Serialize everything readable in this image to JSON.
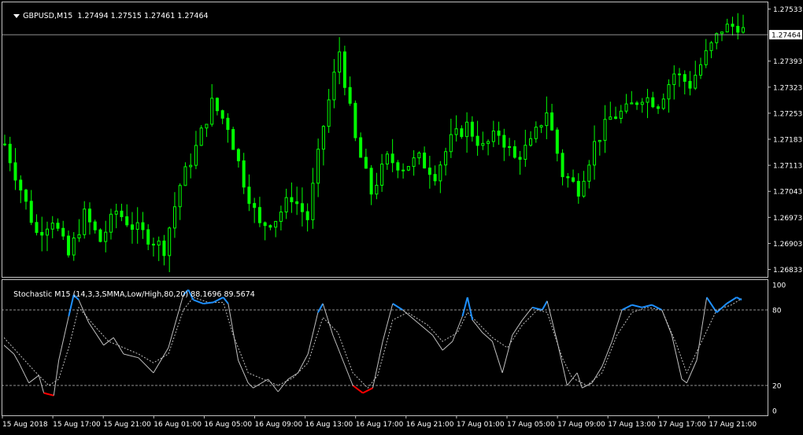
{
  "main_chart": {
    "symbol": "GBPUSD,M15",
    "ohlc": "1.27494 1.27515 1.27461 1.27464",
    "current_price": "1.27464",
    "price_ticks": [
      "1.27533",
      "1.27393",
      "1.27323",
      "1.27253",
      "1.27183",
      "1.27113",
      "1.27043",
      "1.26973",
      "1.26903",
      "1.26833"
    ]
  },
  "stochastic": {
    "label": "Stochastic M15 (14,3,3,SMMA,Low/High,80,20) 88.1696 89.5674",
    "value_ticks": [
      "100",
      "80",
      "20",
      "0"
    ],
    "overbought_level": 80,
    "oversold_level": 20
  },
  "time_ticks": [
    "15 Aug 2018",
    "15 Aug 17:00",
    "15 Aug 21:00",
    "16 Aug 01:00",
    "16 Aug 05:00",
    "16 Aug 09:00",
    "16 Aug 13:00",
    "16 Aug 17:00",
    "16 Aug 21:00",
    "17 Aug 01:00",
    "17 Aug 05:00",
    "17 Aug 09:00",
    "17 Aug 13:00",
    "17 Aug 17:00",
    "17 Aug 21:00"
  ],
  "colors": {
    "background": "#000000",
    "grid_border": "#c0c0c0",
    "candle": "#00ff00",
    "main_line": "#c0c0c0",
    "signal_line": "#c0c0c0",
    "overbought": "#1e90ff",
    "oversold": "#ff0000"
  },
  "chart_data": [
    {
      "type": "candlestick",
      "symbol": "GBPUSD",
      "timeframe": "M15",
      "ylim": [
        1.26813,
        1.27553
      ],
      "last": 1.27464,
      "close_path": [
        [
          0,
          1.2717
        ],
        [
          3,
          1.2705
        ],
        [
          6,
          1.2693
        ],
        [
          9,
          1.2697
        ],
        [
          12,
          1.2687
        ],
        [
          15,
          1.2698
        ],
        [
          18,
          1.2691
        ],
        [
          21,
          1.2699
        ],
        [
          24,
          1.2695
        ],
        [
          27,
          1.2692
        ],
        [
          30,
          1.2689
        ],
        [
          33,
          1.2706
        ],
        [
          36,
          1.2716
        ],
        [
          39,
          1.2728
        ],
        [
          42,
          1.2722
        ],
        [
          45,
          1.2707
        ],
        [
          48,
          1.2695
        ],
        [
          51,
          1.2697
        ],
        [
          54,
          1.2703
        ],
        [
          57,
          1.2697
        ],
        [
          60,
          1.2722
        ],
        [
          63,
          1.2742
        ],
        [
          66,
          1.2718
        ],
        [
          69,
          1.2704
        ],
        [
          72,
          1.2713
        ],
        [
          75,
          1.2711
        ],
        [
          78,
          1.2713
        ],
        [
          81,
          1.2709
        ],
        [
          84,
          1.2718
        ],
        [
          87,
          1.2722
        ],
        [
          90,
          1.2716
        ],
        [
          93,
          1.272
        ],
        [
          96,
          1.2713
        ],
        [
          99,
          1.2717
        ],
        [
          102,
          1.2726
        ],
        [
          105,
          1.2709
        ],
        [
          108,
          1.2705
        ],
        [
          111,
          1.2717
        ],
        [
          114,
          1.2724
        ],
        [
          117,
          1.2726
        ],
        [
          120,
          1.273
        ],
        [
          123,
          1.2728
        ],
        [
          126,
          1.2736
        ],
        [
          129,
          1.2733
        ],
        [
          132,
          1.2741
        ],
        [
          135,
          1.2748
        ],
        [
          138,
          1.2749
        ],
        [
          140,
          1.2746
        ]
      ]
    },
    {
      "type": "line",
      "name": "Stochastic (14,3,3,SMMA,Low/High,80,20)",
      "ylim": [
        0,
        100
      ],
      "levels": [
        20,
        80
      ],
      "last_main": 88.1696,
      "last_signal": 89.5674,
      "main": [
        [
          0,
          52
        ],
        [
          2,
          45
        ],
        [
          3,
          38
        ],
        [
          5,
          22
        ],
        [
          7,
          28
        ],
        [
          8,
          14
        ],
        [
          10,
          12
        ],
        [
          11,
          40
        ],
        [
          13,
          75
        ],
        [
          14,
          92
        ],
        [
          15,
          88
        ],
        [
          17,
          70
        ],
        [
          20,
          52
        ],
        [
          22,
          58
        ],
        [
          24,
          45
        ],
        [
          27,
          42
        ],
        [
          30,
          30
        ],
        [
          33,
          50
        ],
        [
          36,
          92
        ],
        [
          37,
          96
        ],
        [
          38,
          88
        ],
        [
          40,
          85
        ],
        [
          42,
          86
        ],
        [
          44,
          90
        ],
        [
          45,
          85
        ],
        [
          47,
          40
        ],
        [
          49,
          22
        ],
        [
          50,
          18
        ],
        [
          53,
          25
        ],
        [
          55,
          15
        ],
        [
          57,
          25
        ],
        [
          59,
          30
        ],
        [
          61,
          45
        ],
        [
          63,
          78
        ],
        [
          64,
          85
        ],
        [
          66,
          60
        ],
        [
          68,
          40
        ],
        [
          70,
          20
        ],
        [
          72,
          14
        ],
        [
          74,
          18
        ],
        [
          76,
          55
        ],
        [
          78,
          85
        ],
        [
          80,
          80
        ],
        [
          83,
          70
        ],
        [
          86,
          60
        ],
        [
          88,
          48
        ],
        [
          90,
          55
        ],
        [
          92,
          75
        ],
        [
          93,
          90
        ],
        [
          94,
          72
        ],
        [
          96,
          62
        ],
        [
          98,
          55
        ],
        [
          100,
          30
        ],
        [
          102,
          60
        ],
        [
          104,
          72
        ],
        [
          106,
          82
        ],
        [
          108,
          80
        ],
        [
          109,
          87
        ],
        [
          111,
          55
        ],
        [
          113,
          20
        ],
        [
          115,
          30
        ],
        [
          116,
          18
        ],
        [
          118,
          22
        ],
        [
          120,
          35
        ],
        [
          122,
          55
        ],
        [
          124,
          80
        ],
        [
          126,
          84
        ],
        [
          128,
          82
        ],
        [
          130,
          84
        ],
        [
          132,
          80
        ],
        [
          134,
          60
        ],
        [
          136,
          25
        ],
        [
          137,
          22
        ],
        [
          139,
          40
        ],
        [
          141,
          90
        ],
        [
          143,
          78
        ],
        [
          145,
          85
        ],
        [
          147,
          90
        ],
        [
          148,
          88
        ]
      ],
      "signal": [
        [
          0,
          58
        ],
        [
          3,
          45
        ],
        [
          6,
          32
        ],
        [
          9,
          20
        ],
        [
          11,
          25
        ],
        [
          13,
          50
        ],
        [
          15,
          82
        ],
        [
          18,
          68
        ],
        [
          21,
          55
        ],
        [
          24,
          50
        ],
        [
          27,
          45
        ],
        [
          30,
          38
        ],
        [
          33,
          45
        ],
        [
          36,
          80
        ],
        [
          38,
          90
        ],
        [
          41,
          86
        ],
        [
          44,
          86
        ],
        [
          46,
          60
        ],
        [
          49,
          30
        ],
        [
          52,
          25
        ],
        [
          55,
          20
        ],
        [
          58,
          26
        ],
        [
          61,
          38
        ],
        [
          64,
          74
        ],
        [
          67,
          62
        ],
        [
          70,
          30
        ],
        [
          73,
          18
        ],
        [
          75,
          28
        ],
        [
          78,
          72
        ],
        [
          81,
          78
        ],
        [
          85,
          68
        ],
        [
          88,
          55
        ],
        [
          91,
          62
        ],
        [
          93,
          78
        ],
        [
          95,
          70
        ],
        [
          98,
          58
        ],
        [
          101,
          50
        ],
        [
          104,
          68
        ],
        [
          107,
          80
        ],
        [
          109,
          78
        ],
        [
          112,
          42
        ],
        [
          114,
          26
        ],
        [
          117,
          20
        ],
        [
          120,
          30
        ],
        [
          123,
          60
        ],
        [
          126,
          78
        ],
        [
          129,
          82
        ],
        [
          132,
          80
        ],
        [
          135,
          52
        ],
        [
          137,
          30
        ],
        [
          140,
          55
        ],
        [
          143,
          80
        ],
        [
          146,
          84
        ],
        [
          148,
          89
        ]
      ]
    }
  ]
}
